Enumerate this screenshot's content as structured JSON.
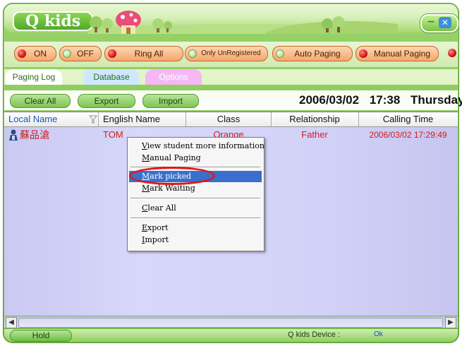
{
  "app": {
    "logo_text": "Q kids",
    "window_buttons": {
      "minimize_icon": "minus-icon",
      "close_icon": "x-icon"
    }
  },
  "paging": {
    "buttons": [
      {
        "label": "ON",
        "indicator": "red"
      },
      {
        "label": "OFF",
        "indicator": "green"
      },
      {
        "label": "Ring All",
        "indicator": "red"
      },
      {
        "label": "Only UnRegistered",
        "indicator": "green"
      },
      {
        "label": "Auto Paging",
        "indicator": "green"
      },
      {
        "label": "Manual Paging",
        "indicator": "red"
      }
    ]
  },
  "tabs": [
    {
      "label": "Paging Log",
      "active": true,
      "color": "#ffffff"
    },
    {
      "label": "Database",
      "active": false,
      "color": "#cfe8ff"
    },
    {
      "label": "Options",
      "active": false,
      "color": "#f5b8f5"
    }
  ],
  "actions": {
    "clear_all": "Clear All",
    "export": "Export",
    "import": "Import"
  },
  "clock": {
    "date": "2006/03/02",
    "time": "17:38",
    "weekday": "Thursday"
  },
  "table": {
    "columns": [
      "Local Name",
      "English Name",
      "Class",
      "Relationship",
      "Calling Time"
    ],
    "rows": [
      {
        "local_name": "蘇品滄",
        "english_name": "TOM",
        "class": "Orange",
        "relationship": "Father",
        "calling_time": "2006/03/02 17:29:49",
        "icon": "person-icon"
      }
    ]
  },
  "context_menu": {
    "items": [
      {
        "label": "View student more information",
        "key": "V"
      },
      {
        "label": "Manual Paging",
        "key": "M"
      },
      {
        "label": "Mark picked",
        "key": "M",
        "selected": true
      },
      {
        "label": "Mark Waiting",
        "key": "M"
      },
      {
        "label": "Clear All",
        "key": "C"
      },
      {
        "label": "Export",
        "key": "E"
      },
      {
        "label": "Import",
        "key": "I"
      }
    ]
  },
  "status": {
    "hold": "Hold",
    "device_label": "Q kids Device :",
    "device_value": "Ok"
  },
  "colors": {
    "frame_green": "#7ac246",
    "row_red": "#d21d1d",
    "menu_highlight": "#3a6fcd",
    "annotation_red": "#e01717"
  }
}
